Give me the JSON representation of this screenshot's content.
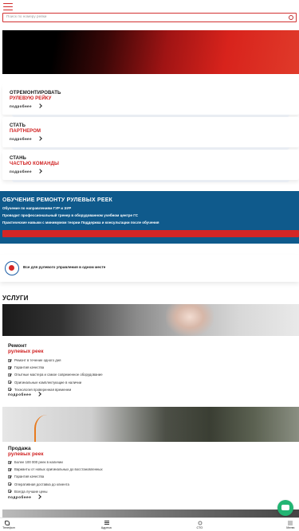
{
  "header": {
    "search_placeholder": "Поиск по номеру рейки"
  },
  "promos": [
    {
      "line1": "ОТРЕМОНТИРОВАТЬ",
      "line2": "РУЛЕВУЮ РЕЙКУ",
      "more": "подробнее"
    },
    {
      "line1": "СТАТЬ",
      "line2": "ПАРТНЕРОМ",
      "more": "подробнее"
    },
    {
      "line1": "СТАНЬ",
      "line2": "ЧАСТЬЮ КОМАНДЫ",
      "more": "подробнее"
    }
  ],
  "education": {
    "title": "ОБУЧЕНИЕ РЕМОНТУ РУЛЕВЫХ РЕЕК",
    "lines": [
      "Обучение по направлениям ГУР и ЭУР",
      "Проводит профессиональный тренер в оборудованном учебном центре ГС",
      "Практические навыки с минимумом теории Поддержка и консультации после обучения"
    ]
  },
  "onestop": {
    "text": "Все для рулевого управления в одном месте"
  },
  "services": {
    "title": "УСЛУГИ",
    "items": [
      {
        "title_black": "Ремонт",
        "title_red": "рулевых реек",
        "bullets": [
          "Ремонт в течение одного дня",
          "Гарантия качества",
          "Опытные мастера и самое современное оборудование",
          "Оригинальные комплектующие в наличии",
          "Технология проверенная временем"
        ],
        "more": "подробнее"
      },
      {
        "title_black": "Продажа",
        "title_red": "рулевых реек",
        "bullets": [
          "Более 100 000 реек в наличии",
          "Варианты от новых оригинальных до восстановленных",
          "Гарантия качества",
          "Оперативная доставка до клиента",
          "Всегда лучшие цены"
        ],
        "more": "подробнее"
      }
    ]
  },
  "bottom_nav": [
    {
      "label": "Телефон",
      "icon": "phone-icon"
    },
    {
      "label": "Адреса",
      "icon": "list-icon"
    },
    {
      "label": "СТО",
      "icon": "wrench-icon"
    },
    {
      "label": "Меню",
      "icon": "grid-icon"
    }
  ],
  "colors": {
    "accent_red": "#d02020",
    "education_blue": "#0f5a8c",
    "chat_green": "#22b573"
  }
}
